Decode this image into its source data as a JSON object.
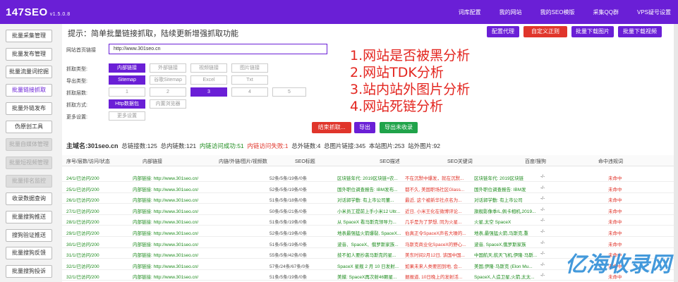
{
  "header": {
    "logo": "147SEO",
    "version": "v1.5.0.8",
    "nav": [
      "词库配置",
      "我的网站",
      "我的SEO模版",
      "采集QQ群",
      "VPS疑号设置"
    ]
  },
  "sidebar": {
    "items": [
      {
        "label": "批量采集管理",
        "state": "normal"
      },
      {
        "label": "批量发布管理",
        "state": "normal"
      },
      {
        "label": "批量流量词挖掘",
        "state": "normal"
      },
      {
        "label": "批量链接抓取",
        "state": "active"
      },
      {
        "label": "批量外链发布",
        "state": "normal"
      },
      {
        "label": "伪原创工具",
        "state": "normal"
      },
      {
        "label": "批量自媒体管理",
        "state": "disabled"
      },
      {
        "label": "批量短视频管理",
        "state": "disabled"
      },
      {
        "label": "批量排名监控",
        "state": "disabled"
      },
      {
        "label": "收录数据查询",
        "state": "normal"
      },
      {
        "label": "批量搜狗推送",
        "state": "normal"
      },
      {
        "label": "搜狗验证推送",
        "state": "normal"
      },
      {
        "label": "批量搜狗反馈",
        "state": "normal"
      },
      {
        "label": "批量搜狗投诉",
        "state": "normal"
      }
    ]
  },
  "main": {
    "tip": "提示：简单批量链接抓取，陆续更新增强抓取功能",
    "top_buttons": [
      "配置代理",
      "自定义正则",
      "批量下载图片",
      "批量下载视频"
    ],
    "url_label": "网站首页链接",
    "url_value": "http://www.301seo.cn",
    "crawl_type_label": "抓取类型:",
    "crawl_types": [
      "内部链接",
      "外部链接",
      "视频链接",
      "图片链接"
    ],
    "export_label": "导出类型:",
    "export_types": [
      "Sitemap",
      "谷歌Sitemap",
      "Excel",
      "Txt"
    ],
    "depth_label": "抓取层数:",
    "depths": [
      "1",
      "2",
      "3",
      "4",
      "5"
    ],
    "method_label": "抓取方式:",
    "methods": [
      "Http数据包",
      "内置浏览器"
    ],
    "more_label": "更多设置:",
    "more_button": "更多设置",
    "action_buttons": [
      "结束抓取...",
      "导出",
      "导出未收录"
    ],
    "annotations": [
      "1.网站是否被黑分析",
      "2.网站TDK分析",
      "3.站内站外图片分析",
      "4.网站死链分析"
    ],
    "summary": {
      "host_label": "主域名:",
      "host": "301seo.cn",
      "total_links": "总链接数:125",
      "internal": "总内链数:121",
      "success": "内链访问成功:51",
      "fail": "内链访问失败:1",
      "external": "总外链数:4",
      "images": "总图片链接:345",
      "site_images": "本站图片:253",
      "outside_images": "站外图片:92"
    },
    "columns": [
      "序号/层数/访问/状态",
      "内部链接",
      "内链/外链/图片/视频数",
      "SEO标题",
      "SEO描述",
      "SEO关键词",
      "百度/搜狗",
      "命中违规词"
    ],
    "rows": [
      {
        "status": "24/1/已访问/200",
        "link": "内部链接: http://www.301seo.cn/",
        "counts": "52条/5条/19条/0条",
        "title": "区块链年代: 2019区块链+农...",
        "desc": "不在沉默中爆发，就在沉默...",
        "kw": "区块链年代: 2019区块链",
        "rank": "-/-",
        "hit": "未命中"
      },
      {
        "status": "25/1/已访问/200",
        "link": "内部链接: http://www.301seo.cn/",
        "counts": "52条/5条/19条/0条",
        "title": "国外职位调查报告: IBM发布...",
        "desc": "都不久, 美国职场社区Glass...",
        "kw": "国外职位调查报告: IBM发",
        "rank": "-/-",
        "hit": "未命中"
      },
      {
        "status": "26/1/已访问/200",
        "link": "内部链接: http://www.301seo.cn/",
        "counts": "51条/5条/18条/0条",
        "title": "对话郭学勤: 有上市公司董...",
        "desc": "最近, 这个被新华社点名为...",
        "kw": "对话郭学勤: 有上市公司",
        "rank": "-/-",
        "hit": "未命中"
      },
      {
        "status": "27/1/已访问/200",
        "link": "内部链接: http://www.301seo.cn/",
        "counts": "50条/5条/21条/0条",
        "title": "小米员工提前上手小米12 Ultr...",
        "desc": "近日, 小米王化在微博评论...",
        "kw": "旗舰影像季/L,佩卡相机,2019...",
        "rank": "-/-",
        "hit": "未命中"
      },
      {
        "status": "28/1/已访问/200",
        "link": "内部链接: http://www.301seo.cn/",
        "counts": "51条/5条/19条/0条",
        "title": "从 SpaceX 看马斯克领导力...",
        "desc": "几乎是为了梦想, 同为火星...",
        "kw": "火星,太空 SpaceX",
        "rank": "-/-",
        "hit": "未命中"
      },
      {
        "status": "29/1/已访问/200",
        "link": "内部链接: http://www.301seo.cn/",
        "counts": "52条/5条/19条/0条",
        "title": "地表最强猛火箭爆裂, SpaceX...",
        "desc": "伯真正令SpaceX声名大噪的...",
        "kw": "地表,最强猛火箭,马斯克,重",
        "rank": "-/-",
        "hit": "未命中"
      },
      {
        "status": "30/1/已访问/200",
        "link": "内部链接: http://www.301seo.cn/",
        "counts": "51条/5条/19条/0条",
        "title": "波音、SpaceX、俄罗斯家族...",
        "desc": "马斯克商业化SpaceX的野心...",
        "kw": "波音, SpaceX,俄罗斯家族",
        "rank": "-/-",
        "hit": "未命中"
      },
      {
        "status": "31/1/已访问/200",
        "link": "内部链接: http://www.301seo.cn/",
        "counts": "55条/5条/42条/0条",
        "title": "技不如人要抄袭马斯克的星...",
        "desc": "美东时间2月12日, 该国中国...",
        "kw": "中国航天,航天飞机,伊隆·马斯...",
        "rank": "-/-",
        "hit": "未命中"
      },
      {
        "status": "32/1/已访问/200",
        "link": "内部链接: http://www.301seo.cn/",
        "counts": "57条/24条/67条/0条",
        "title": "SpaceX 星舰 2 月 10 日发射...",
        "desc": "如果未来人类要回到地, 会...",
        "kw": "美国,伊隆·马斯克 (Elon Mu...",
        "rank": "-/-",
        "hit": "未命中"
      },
      {
        "status": "32/1/已访问/200",
        "link": "内部链接: http://www.301seo.cn/",
        "counts": "51条/5条/19条/0条",
        "title": "美媒: SpaceX再次射46颗星...",
        "desc": "据报道, 10日晚上的发射活...",
        "kw": "SpaceX,人造卫星,火箭,太太...",
        "rank": "-/-",
        "hit": "未命中"
      }
    ]
  },
  "watermark": "亿海收录网",
  "colors": {
    "brand": "#6a1fd6",
    "red": "#e0352b",
    "green": "#20a34a"
  }
}
